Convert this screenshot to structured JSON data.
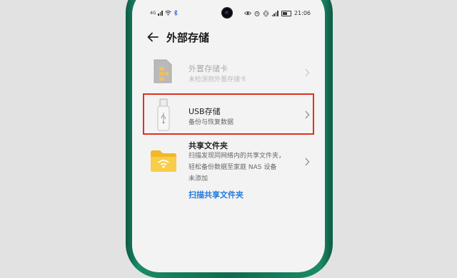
{
  "status": {
    "time": "21:06",
    "left_text": "4G"
  },
  "header": {
    "title": "外部存储"
  },
  "items": [
    {
      "title": "外置存储卡",
      "subtitle": "未检测到外置存储卡"
    },
    {
      "title": "USB存储",
      "subtitle": "备份与恢复数据"
    },
    {
      "title": "共享文件夹",
      "subtitle_lines": [
        "扫描发现同网络内的共享文件夹，",
        "轻松备份数据至家庭 NAS 设备",
        "未添加"
      ],
      "link": "扫描共享文件夹"
    }
  ],
  "colors": {
    "highlight_border": "#e0301e",
    "link": "#1f7ae0",
    "phone_frame": "#0f6b4f"
  },
  "icons": [
    "back-arrow-icon",
    "sd-card-icon",
    "usb-drive-icon",
    "folder-network-icon",
    "chevron-right-icon"
  ]
}
